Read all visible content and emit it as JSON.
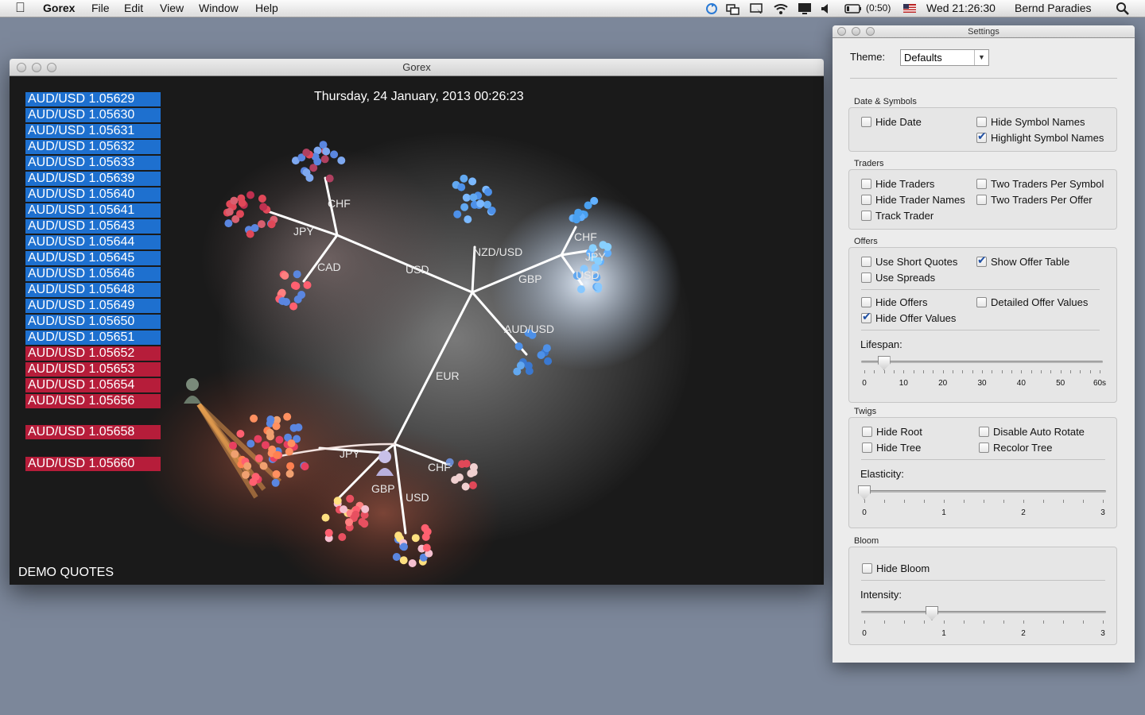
{
  "menubar": {
    "app": "Gorex",
    "items": [
      "File",
      "Edit",
      "View",
      "Window",
      "Help"
    ],
    "battery": "(0:50)",
    "clock": "Wed 21:26:30",
    "user": "Bernd Paradies"
  },
  "gorex_window": {
    "title": "Gorex",
    "date": "Thursday, 24 January, 2013 00:26:23",
    "demo_label": "DEMO QUOTES",
    "quotes": [
      {
        "text": "AUD/USD 1.05629",
        "color": "blue"
      },
      {
        "text": "AUD/USD 1.05630",
        "color": "blue"
      },
      {
        "text": "AUD/USD 1.05631",
        "color": "blue"
      },
      {
        "text": "AUD/USD 1.05632",
        "color": "blue"
      },
      {
        "text": "AUD/USD 1.05633",
        "color": "blue"
      },
      {
        "text": "AUD/USD 1.05639",
        "color": "blue"
      },
      {
        "text": "AUD/USD 1.05640",
        "color": "blue"
      },
      {
        "text": "AUD/USD 1.05641",
        "color": "blue"
      },
      {
        "text": "AUD/USD 1.05643",
        "color": "blue"
      },
      {
        "text": "AUD/USD 1.05644",
        "color": "blue"
      },
      {
        "text": "AUD/USD 1.05645",
        "color": "blue"
      },
      {
        "text": "AUD/USD 1.05646",
        "color": "blue"
      },
      {
        "text": "AUD/USD 1.05648",
        "color": "blue"
      },
      {
        "text": "AUD/USD 1.05649",
        "color": "blue"
      },
      {
        "text": "AUD/USD 1.05650",
        "color": "blue"
      },
      {
        "text": "AUD/USD 1.05651",
        "color": "blue"
      },
      {
        "text": "AUD/USD 1.05652",
        "color": "red"
      },
      {
        "text": "AUD/USD 1.05653",
        "color": "red"
      },
      {
        "text": "AUD/USD 1.05654",
        "color": "red"
      },
      {
        "text": "AUD/USD 1.05656",
        "color": "red"
      },
      {
        "text": "AUD/USD 1.05658",
        "color": "red"
      },
      {
        "text": "AUD/USD 1.05660",
        "color": "red"
      }
    ],
    "tree_labels": [
      "CHF",
      "JPY",
      "CAD",
      "USD",
      "NZD/USD",
      "GBP",
      "CHF",
      "JPY",
      "USD",
      "AUD/USD",
      "EUR",
      "JPY",
      "CHF",
      "GBP",
      "USD"
    ]
  },
  "settings": {
    "title": "Settings",
    "theme_label": "Theme:",
    "theme_value": "Defaults",
    "sections": {
      "date_symbols": "Date & Symbols",
      "traders": "Traders",
      "offers": "Offers",
      "twigs": "Twigs",
      "bloom": "Bloom"
    },
    "checkboxes": {
      "hide_date": {
        "label": "Hide Date",
        "checked": false
      },
      "hide_symbol_names": {
        "label": "Hide Symbol Names",
        "checked": false
      },
      "highlight_symbol_names": {
        "label": "Highlight Symbol Names",
        "checked": true
      },
      "hide_traders": {
        "label": "Hide Traders",
        "checked": false
      },
      "two_traders_per_symbol": {
        "label": "Two Traders Per Symbol",
        "checked": false
      },
      "hide_trader_names": {
        "label": "Hide Trader Names",
        "checked": false
      },
      "two_traders_per_offer": {
        "label": "Two Traders Per Offer",
        "checked": false
      },
      "track_trader": {
        "label": "Track Trader",
        "checked": false
      },
      "use_short_quotes": {
        "label": "Use Short Quotes",
        "checked": false
      },
      "show_offer_table": {
        "label": "Show Offer Table",
        "checked": true
      },
      "use_spreads": {
        "label": "Use Spreads",
        "checked": false
      },
      "hide_offers": {
        "label": "Hide Offers",
        "checked": false
      },
      "detailed_offer_values": {
        "label": "Detailed Offer Values",
        "checked": false
      },
      "hide_offer_values": {
        "label": "Hide Offer Values",
        "checked": true
      },
      "hide_root": {
        "label": "Hide Root",
        "checked": false
      },
      "disable_auto_rotate": {
        "label": "Disable Auto Rotate",
        "checked": false
      },
      "hide_tree": {
        "label": "Hide Tree",
        "checked": false
      },
      "recolor_tree": {
        "label": "Recolor Tree",
        "checked": false
      },
      "hide_bloom": {
        "label": "Hide Bloom",
        "checked": false
      }
    },
    "lifespan": {
      "label": "Lifespan:",
      "ticks": [
        "0",
        "10",
        "20",
        "30",
        "40",
        "50",
        "60s"
      ],
      "value": 5
    },
    "elasticity": {
      "label": "Elasticity:",
      "ticks": [
        "0",
        "1",
        "2",
        "3"
      ],
      "value": 0
    },
    "intensity": {
      "label": "Intensity:",
      "ticks": [
        "0",
        "1",
        "2",
        "3"
      ],
      "value": 0.85
    }
  }
}
